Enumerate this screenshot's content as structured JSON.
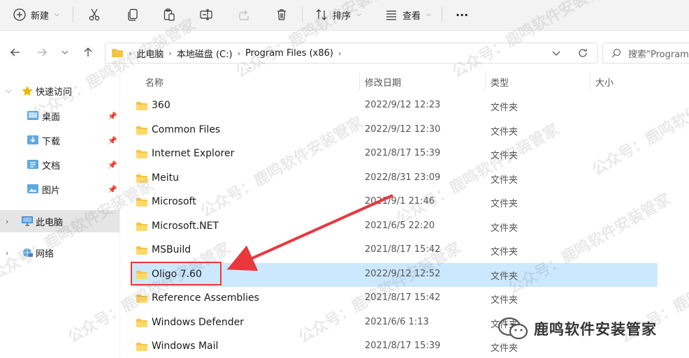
{
  "toolbar": {
    "new_label": "新建",
    "sort_label": "排序",
    "view_label": "查看",
    "more_label": "···"
  },
  "breadcrumb": [
    "此电脑",
    "本地磁盘 (C:)",
    "Program Files (x86)"
  ],
  "search": {
    "placeholder": "搜索\"Program"
  },
  "sidebar": {
    "quick_access": "快速访问",
    "items": [
      {
        "label": "桌面"
      },
      {
        "label": "下载"
      },
      {
        "label": "文档"
      },
      {
        "label": "图片"
      }
    ],
    "this_pc": "此电脑",
    "network": "网络"
  },
  "columns": {
    "name": "名称",
    "date": "修改日期",
    "type": "类型",
    "size": "大小"
  },
  "files": [
    {
      "name": "360",
      "date": "2022/9/12 12:23",
      "type": "文件夹"
    },
    {
      "name": "Common Files",
      "date": "2022/9/12 12:30",
      "type": "文件夹"
    },
    {
      "name": "Internet Explorer",
      "date": "2021/8/17 15:39",
      "type": "文件夹"
    },
    {
      "name": "Meitu",
      "date": "2022/8/31 23:09",
      "type": "文件夹"
    },
    {
      "name": "Microsoft",
      "date": "2021/9/1 21:46",
      "type": "文件夹"
    },
    {
      "name": "Microsoft.NET",
      "date": "2021/6/5 22:20",
      "type": "文件夹"
    },
    {
      "name": "MSBuild",
      "date": "2021/8/17 15:42",
      "type": "文件夹"
    },
    {
      "name": "Oligo 7.60",
      "date": "2022/9/12 12:52",
      "type": "文件夹"
    },
    {
      "name": "Reference Assemblies",
      "date": "2021/8/17 15:42",
      "type": "文件夹"
    },
    {
      "name": "Windows Defender",
      "date": "2021/6/6 1:13",
      "type": "文件夹"
    },
    {
      "name": "Windows Mail",
      "date": "2021/8/17 15:39",
      "type": "文件夹"
    }
  ],
  "selected_index": 7,
  "watermark": {
    "text": "公众号：鹿鸣软件安装管家"
  },
  "badge": {
    "text": "鹿鸣软件安装管家"
  },
  "colors": {
    "selection": "#cce8ff",
    "annotation": "#e8383d",
    "folder": "#f4c542"
  }
}
